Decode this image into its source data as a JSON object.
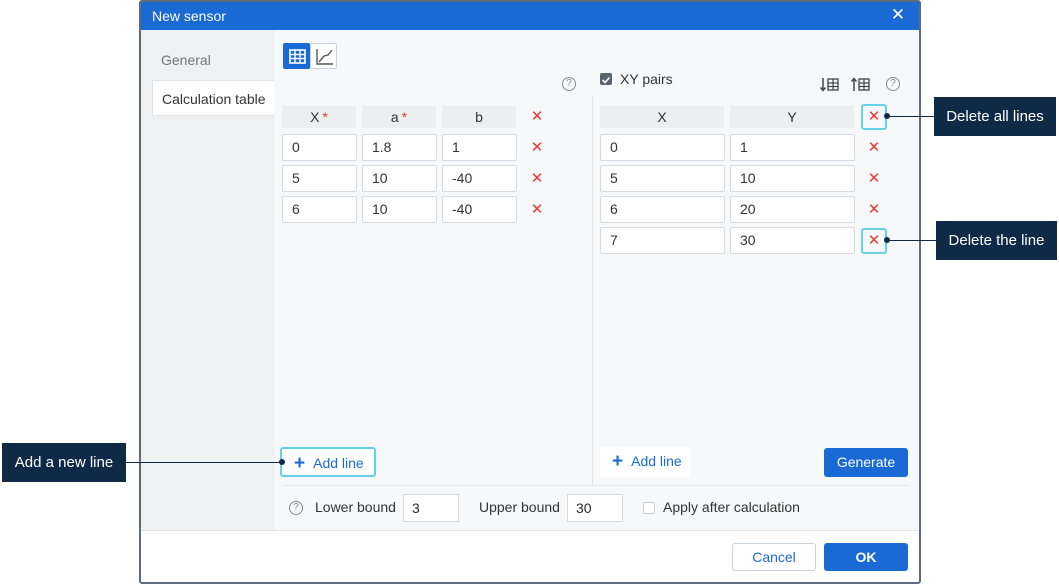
{
  "dialog": {
    "title": "New sensor"
  },
  "sidebar": {
    "items": [
      {
        "label": "General"
      },
      {
        "label": "Calculation table"
      }
    ]
  },
  "view_toggle": {
    "table_icon": "table-icon",
    "chart_icon": "chart-icon"
  },
  "left_table": {
    "headers": [
      "X",
      "a",
      "b"
    ],
    "required_marker": "*",
    "rows": [
      [
        "0",
        "1.8",
        "1"
      ],
      [
        "5",
        "10",
        "-40"
      ],
      [
        "6",
        "10",
        "-40"
      ]
    ],
    "add_line": "Add line"
  },
  "right_table": {
    "xy_pairs_label": "XY pairs",
    "xy_pairs_checked": true,
    "headers": [
      "X",
      "Y"
    ],
    "rows": [
      [
        "0",
        "1"
      ],
      [
        "5",
        "10"
      ],
      [
        "6",
        "20"
      ],
      [
        "7",
        "30"
      ]
    ],
    "add_line": "Add line",
    "generate": "Generate"
  },
  "bounds": {
    "lower_label": "Lower bound",
    "lower_value": "3",
    "upper_label": "Upper bound",
    "upper_value": "30",
    "apply_label": "Apply after calculation",
    "apply_checked": false
  },
  "footer": {
    "cancel": "Cancel",
    "ok": "OK"
  },
  "callouts": {
    "delete_all": "Delete all lines",
    "delete_line": "Delete the line",
    "add_new": "Add a new line"
  },
  "colors": {
    "accent": "#1a6ad6",
    "delete": "#e53935",
    "callout_bg": "#0e2a47",
    "highlight": "#62d3e6"
  }
}
